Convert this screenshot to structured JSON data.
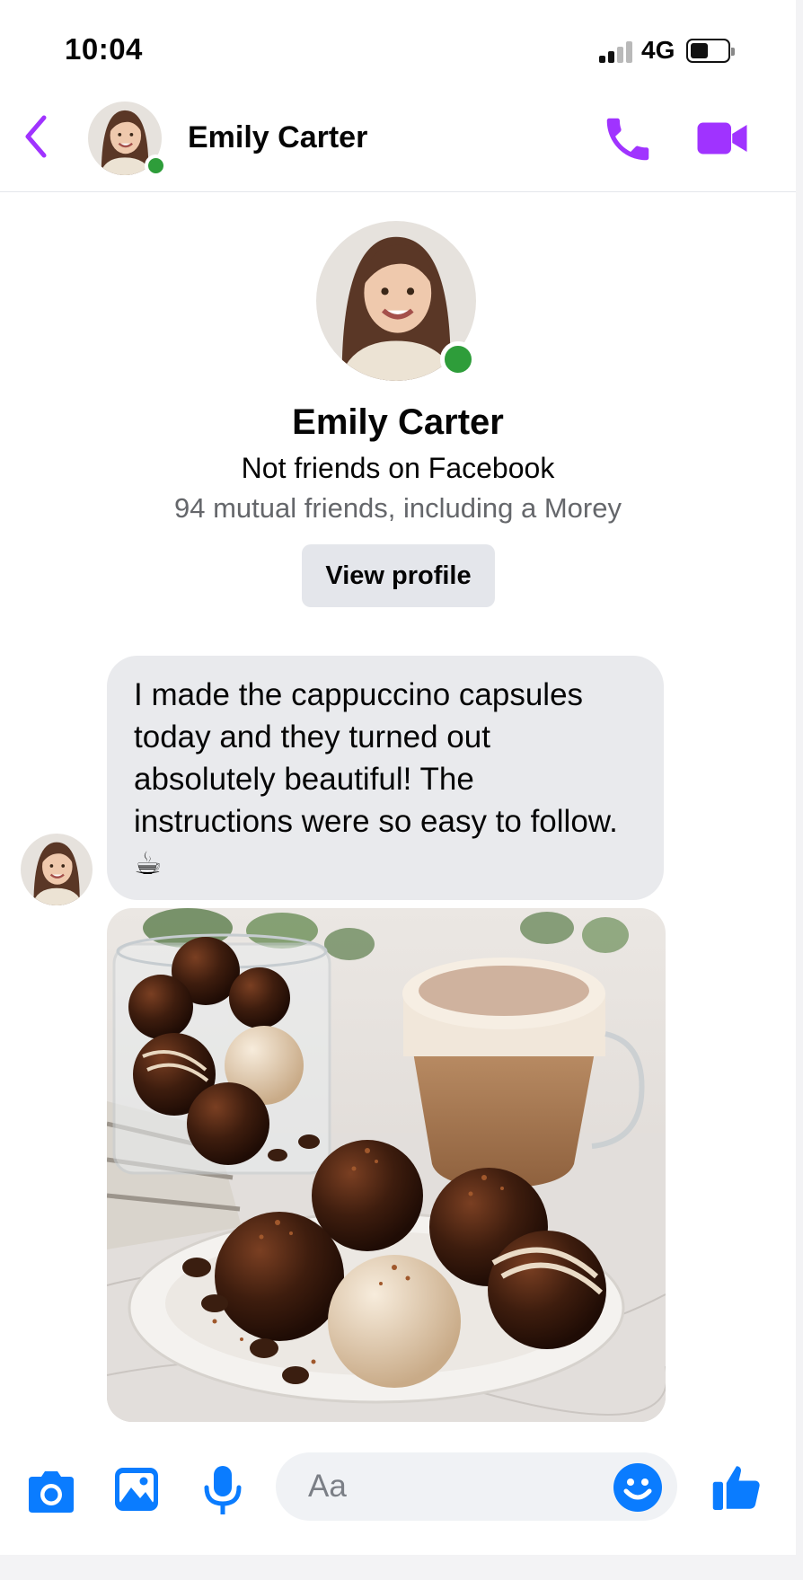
{
  "status_bar": {
    "time": "10:04",
    "network": "4G",
    "signal_icon": "cellular-signal-icon",
    "battery_icon": "battery-icon",
    "battery_level": 0.42
  },
  "header": {
    "back_icon": "chevron-left-icon",
    "contact_name": "Emily Carter",
    "online": true,
    "call_icon": "phone-icon",
    "video_icon": "video-camera-icon"
  },
  "profile": {
    "name": "Emily Carter",
    "relationship": "Not friends on Facebook",
    "mutual_friends": "94 mutual friends, including a Morey",
    "view_profile_label": "View profile"
  },
  "messages": [
    {
      "sender": "Emily Carter",
      "text": "I made the cappuccino capsules today and they turned out absolutely beautiful! The instructions were so easy to follow. ☕",
      "attachment": "photo"
    }
  ],
  "composer": {
    "placeholder": "Aa",
    "camera_icon": "camera-icon",
    "gallery_icon": "image-icon",
    "mic_icon": "microphone-icon",
    "emoji_icon": "smiley-icon",
    "like_icon": "thumbs-up-icon"
  },
  "colors": {
    "accent_purple": "#a033ff",
    "messenger_blue": "#0a7cff",
    "online_green": "#2e9d3a",
    "bubble_gray": "#e9eaed",
    "secondary_text": "#65676b"
  }
}
